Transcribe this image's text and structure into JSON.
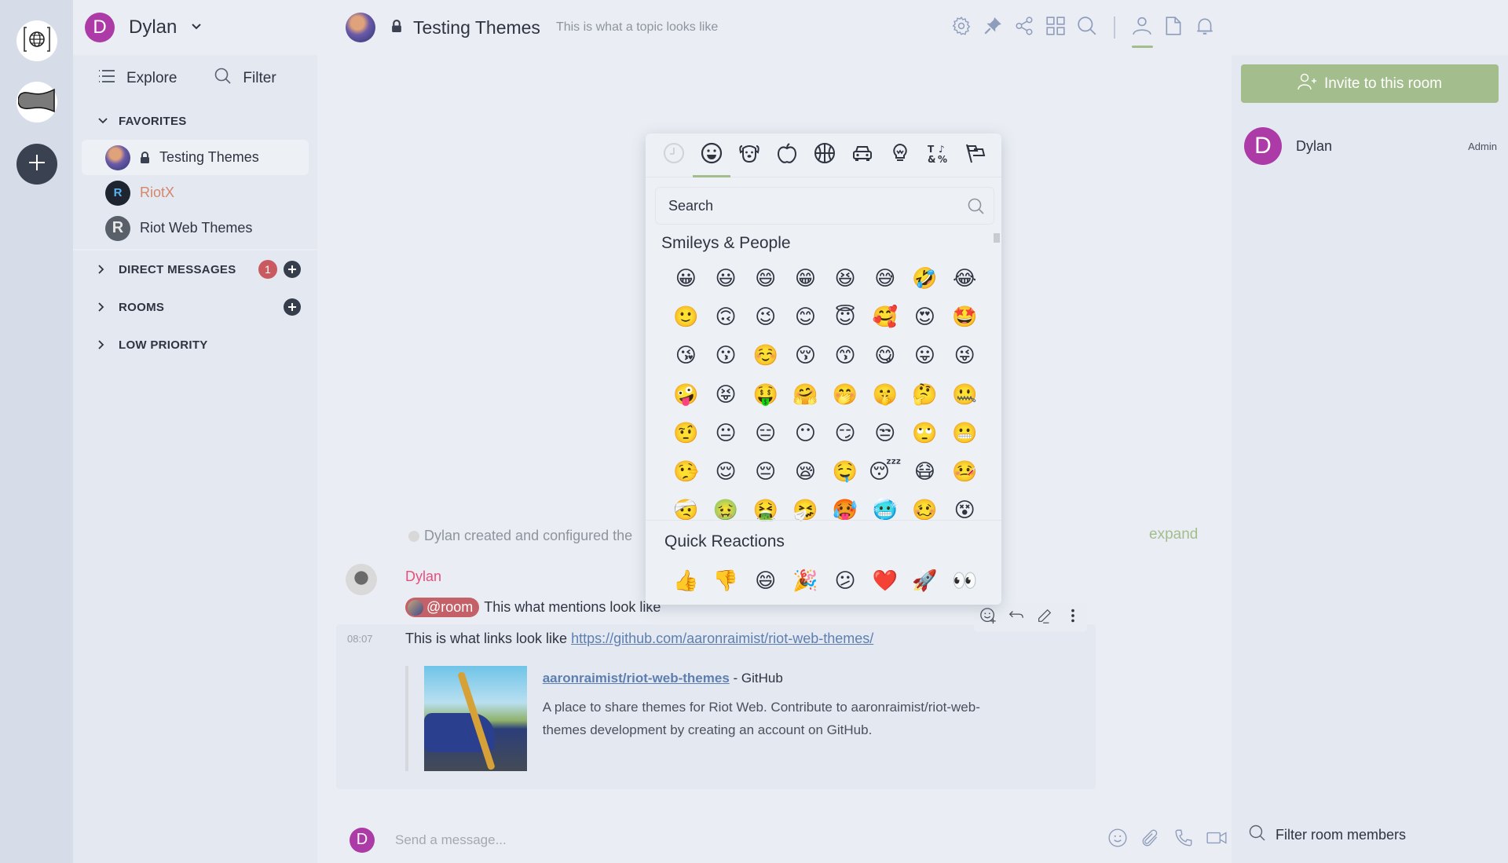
{
  "user": {
    "initial": "D",
    "name": "Dylan",
    "avatar_color": "#ac3ba8"
  },
  "spaces": [
    {
      "name": "Matrix home",
      "icon": "globe-bracket-icon"
    },
    {
      "name": "Community",
      "icon": "community-logo-icon"
    },
    {
      "name": "Create space",
      "icon": "plus-icon"
    }
  ],
  "roomlist": {
    "explore_label": "Explore",
    "filter_label": "Filter",
    "favorites_header": "FAVORITES",
    "favorites": [
      {
        "name": "Testing Themes",
        "encrypted": true,
        "active": true,
        "unread": false
      },
      {
        "name": "RiotX",
        "encrypted": false,
        "active": false,
        "unread": true
      },
      {
        "name": "Riot Web Themes",
        "encrypted": false,
        "active": false,
        "unread": false
      }
    ],
    "direct_messages_header": "DIRECT MESSAGES",
    "direct_messages_badge": "1",
    "rooms_header": "ROOMS",
    "low_priority_header": "LOW PRIORITY"
  },
  "room": {
    "title": "Testing Themes",
    "topic": "This is what a topic looks like",
    "header_icons": [
      "settings-icon",
      "pin-icon",
      "share-icon",
      "apps-icon",
      "search-icon",
      "members-icon",
      "files-icon",
      "notifications-icon"
    ]
  },
  "timeline": {
    "created_text": "Dylan created and configured the",
    "expand_label": "expand",
    "sender": "Dylan",
    "mention_pill": "@room",
    "mention_text": "This what mentions look like",
    "timestamp": "08:07",
    "link_prefix": "This is what links look like ",
    "link_url": "https://github.com/aaronraimist/riot-web-themes/",
    "preview": {
      "title_link": "aaronraimist/riot-web-themes",
      "title_suffix": " - GitHub",
      "description": "A place to share themes for Riot Web. Contribute to aaronraimist/riot-web-themes development by creating an account on GitHub."
    }
  },
  "composer": {
    "placeholder": "Send a message..."
  },
  "right_panel": {
    "invite_label": "Invite to this room",
    "members": [
      {
        "initial": "D",
        "name": "Dylan",
        "power": "Admin"
      }
    ],
    "filter_label": "Filter room members"
  },
  "emoji_picker": {
    "categories": [
      "recent",
      "smileys",
      "animals",
      "food",
      "activity",
      "travel",
      "objects",
      "symbols",
      "flags"
    ],
    "active_category": "smileys",
    "search_placeholder": "Search",
    "section_title": "Smileys & People",
    "emojis": [
      "😀",
      "😃",
      "😄",
      "😁",
      "😆",
      "😅",
      "🤣",
      "😂",
      "🙂",
      "🙃",
      "😉",
      "😊",
      "😇",
      "🥰",
      "😍",
      "🤩",
      "😘",
      "😗",
      "☺️",
      "😚",
      "😙",
      "😋",
      "😛",
      "😜",
      "🤪",
      "😝",
      "🤑",
      "🤗",
      "🤭",
      "🤫",
      "🤔",
      "🤐",
      "🤨",
      "😐",
      "😑",
      "😶",
      "😏",
      "😒",
      "🙄",
      "😬",
      "🤥",
      "😌",
      "😔",
      "😪",
      "🤤",
      "😴",
      "😷",
      "🤒",
      "🤕",
      "🤢",
      "🤮",
      "🤧",
      "🥵",
      "🥶",
      "🥴",
      "😵"
    ],
    "quick_reactions_title": "Quick Reactions",
    "quick_reactions": [
      "👍",
      "👎",
      "😄",
      "🎉",
      "😕",
      "❤️",
      "🚀",
      "👀"
    ]
  },
  "colors": {
    "accent": "#a3bd8c",
    "mention_pill": "#c46068",
    "badge": "#c95b60",
    "link": "#5d7fb0",
    "sender": "#e64f7a",
    "unread_room": "#d6866b"
  }
}
